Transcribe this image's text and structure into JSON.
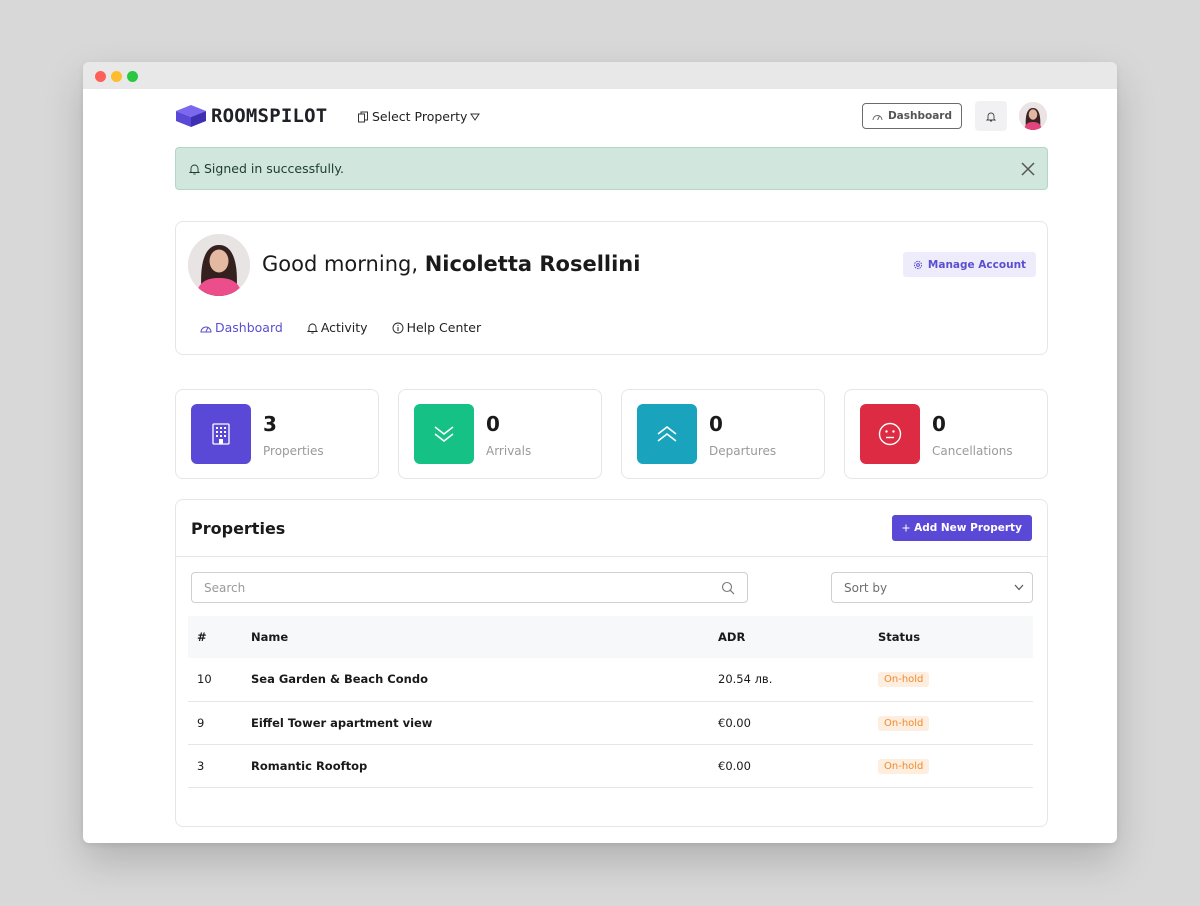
{
  "header": {
    "brand": "ROOMSPILOT",
    "property_select": "Select Property",
    "dashboard_button": "Dashboard"
  },
  "alert": {
    "message": "Signed in successfully."
  },
  "profile": {
    "greeting": "Good morning,",
    "user_name": "Nicoletta Rosellini",
    "manage_account": "Manage Account",
    "tabs": [
      {
        "label": "Dashboard",
        "active": true
      },
      {
        "label": "Activity",
        "active": false
      },
      {
        "label": "Help Center",
        "active": false
      }
    ]
  },
  "stats": [
    {
      "value": "3",
      "label": "Properties",
      "color": "#5a48d6",
      "icon": "building-icon"
    },
    {
      "value": "0",
      "label": "Arrivals",
      "color": "#15c184",
      "icon": "chevron-double-down-icon"
    },
    {
      "value": "0",
      "label": "Departures",
      "color": "#1aa3bd",
      "icon": "chevron-double-up-icon"
    },
    {
      "value": "0",
      "label": "Cancellations",
      "color": "#dc2b42",
      "icon": "neutral-face-icon"
    }
  ],
  "properties": {
    "title": "Properties",
    "add_button": "Add New Property",
    "search_placeholder": "Search",
    "sort_placeholder": "Sort by",
    "columns": [
      "#",
      "Name",
      "ADR",
      "Status"
    ],
    "rows": [
      {
        "id": "10",
        "name": "Sea Garden & Beach Condo",
        "adr": "20.54 лв.",
        "status": "On-hold"
      },
      {
        "id": "9",
        "name": "Eiffel Tower apartment view",
        "adr": "€0.00",
        "status": "On-hold"
      },
      {
        "id": "3",
        "name": "Romantic Rooftop",
        "adr": "€0.00",
        "status": "On-hold"
      }
    ]
  },
  "colors": {
    "accent": "#5a48d6",
    "alert_bg": "#d1e7dd",
    "status_onhold": "#f08a2c"
  }
}
